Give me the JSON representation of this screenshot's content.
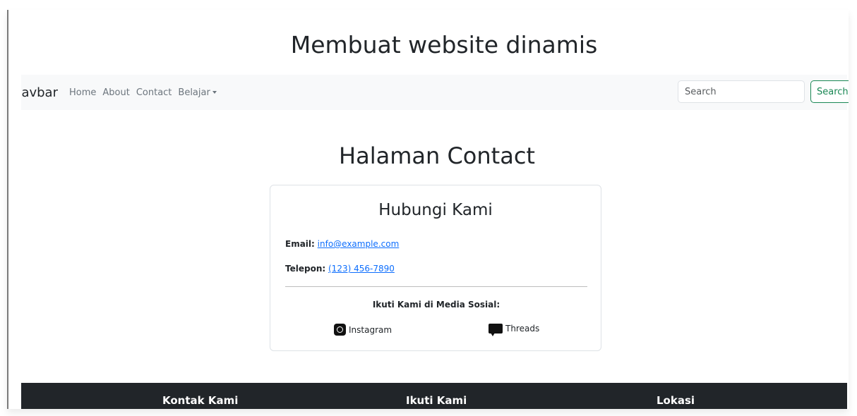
{
  "site": {
    "title": "Membuat website dinamis"
  },
  "navbar": {
    "brand": "Navbar",
    "links": [
      "Home",
      "About",
      "Contact"
    ],
    "dropdown_label": "Belajar",
    "search_placeholder": "Search",
    "search_button": "Search"
  },
  "page": {
    "heading": "Halaman Contact"
  },
  "card": {
    "title": "Hubungi Kami",
    "email_label": "Email:",
    "email_value": "info@example.com",
    "phone_label": "Telepon:",
    "phone_value": "(123) 456-7890",
    "social_heading": "Ikuti Kami di Media Sosial:",
    "social": [
      {
        "label": "Instagram",
        "icon": "instagram-icon"
      },
      {
        "label": "Threads",
        "icon": "threads-icon"
      }
    ]
  },
  "footer": {
    "columns": [
      "Kontak Kami",
      "Ikuti Kami",
      "Lokasi"
    ]
  },
  "colors": {
    "link": "#0d6efd",
    "success": "#198754",
    "footer_bg": "#212529",
    "navbar_bg": "#f8f9fa"
  }
}
